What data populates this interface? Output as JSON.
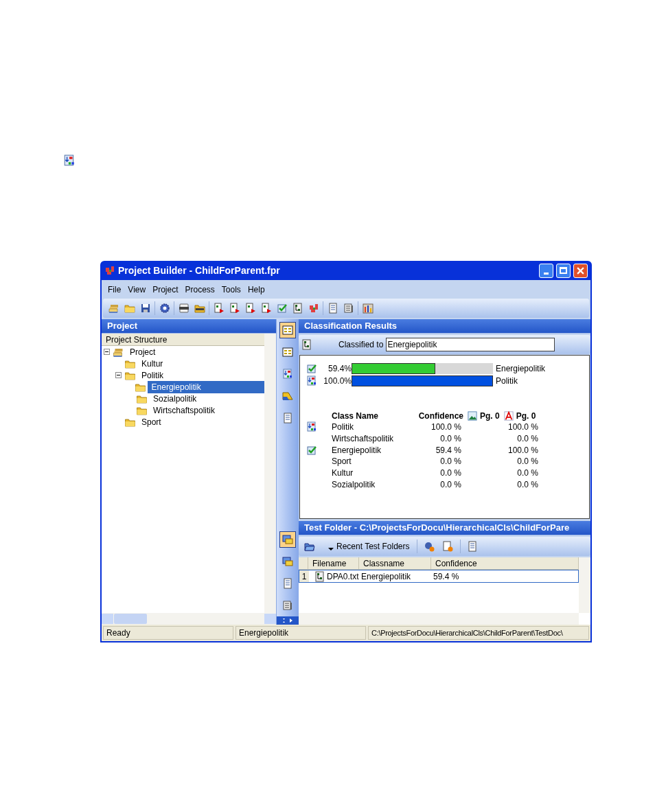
{
  "window": {
    "title": "Project Builder - ChildForParent.fpr"
  },
  "menu": [
    "File",
    "View",
    "Project",
    "Process",
    "Tools",
    "Help"
  ],
  "project_panel": {
    "title": "Project",
    "tree_header": "Project Structure",
    "tree": [
      {
        "label": "Project",
        "kind": "project",
        "expanded": true,
        "selected": false,
        "children": [
          {
            "label": "Kultur",
            "kind": "folder",
            "expanded": false,
            "selected": false
          },
          {
            "label": "Politik",
            "kind": "folder",
            "expanded": true,
            "selected": false,
            "children": [
              {
                "label": "Energiepolitik",
                "kind": "folder",
                "expanded": false,
                "selected": true
              },
              {
                "label": "Sozialpolitik",
                "kind": "folder",
                "expanded": false,
                "selected": false
              },
              {
                "label": "Wirtschaftspolitik",
                "kind": "folder",
                "expanded": false,
                "selected": false
              }
            ]
          },
          {
            "label": "Sport",
            "kind": "folder",
            "expanded": false,
            "selected": false
          }
        ]
      }
    ]
  },
  "side_strip_top": [
    {
      "selected": true
    },
    {
      "selected": false
    },
    {
      "selected": false
    },
    {
      "selected": false
    },
    {
      "selected": false
    }
  ],
  "side_strip_bottom": [
    {
      "selected": true
    },
    {
      "selected": false
    },
    {
      "selected": false
    },
    {
      "selected": false
    }
  ],
  "classification": {
    "title": "Classification Results",
    "classified_label": "Classified to",
    "classified_value": "Energiepolitik",
    "bars": [
      {
        "kind": "match",
        "reading": "59.4%",
        "level": 0.594,
        "color": "#33cc33",
        "label": "Energiepolitik"
      },
      {
        "kind": "parent",
        "reading": "100.0%",
        "level": 1,
        "color": "#0050e0",
        "label": "Politik"
      }
    ],
    "columns": [
      "Class Name",
      "Confidence",
      "Pg. 0",
      "Pg. 0"
    ],
    "rows": [
      {
        "kind": "parent",
        "name": "Politik",
        "confidence": "100.0 %",
        "page": "100.0 %"
      },
      {
        "kind": "none",
        "name": "Wirtschaftspolitik",
        "confidence": "0.0 %",
        "page": "0.0 %"
      },
      {
        "kind": "match",
        "name": "Energiepolitik",
        "confidence": "59.4 %",
        "page": "100.0 %"
      },
      {
        "kind": "none",
        "name": "Sport",
        "confidence": "0.0 %",
        "page": "0.0 %"
      },
      {
        "kind": "none",
        "name": "Kultur",
        "confidence": "0.0 %",
        "page": "0.0 %"
      },
      {
        "kind": "none",
        "name": "Sozialpolitik",
        "confidence": "0.0 %",
        "page": "0.0 %"
      }
    ]
  },
  "test_folder": {
    "title": "Test Folder - C:\\ProjectsForDocu\\HierarchicalCls\\ChildForPare",
    "recent_button": "Recent Test Folders",
    "columns": [
      "Filename",
      "Classname",
      "Confidence"
    ],
    "rows": [
      {
        "index": "1",
        "filename": "DPA0.txt",
        "classname": "Energiepolitik",
        "confidence": "59.4 %",
        "selected": true
      }
    ]
  },
  "status_bar": [
    "Ready",
    "Energiepolitik",
    "C:\\ProjectsForDocu\\HierarchicalCls\\ChildForParent\\TestDoc\\"
  ]
}
